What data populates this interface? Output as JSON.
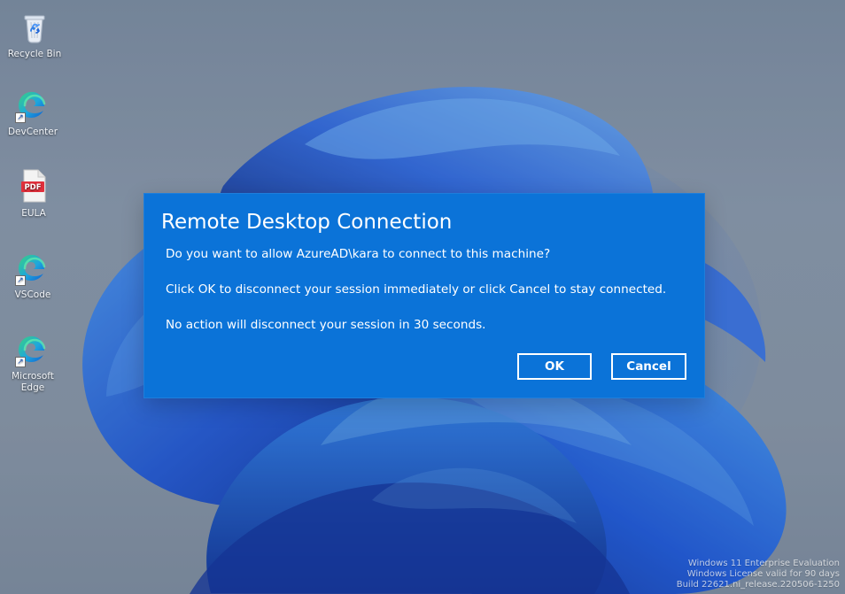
{
  "desktop": {
    "icons": [
      {
        "label": "Recycle Bin"
      },
      {
        "label": "DevCenter"
      },
      {
        "label": "EULA"
      },
      {
        "label": "VSCode"
      },
      {
        "label": "Microsoft Edge"
      }
    ],
    "watermark": {
      "line1": "Windows 11 Enterprise Evaluation",
      "line2": "Windows License valid for 90 days",
      "line3": "Build 22621.ni_release.220506-1250"
    }
  },
  "dialog": {
    "title": "Remote Desktop Connection",
    "lines": [
      "Do you want to allow AzureAD\\kara to connect to this machine?",
      "Click OK to disconnect your session immediately or click Cancel to stay connected.",
      "No action will disconnect your session in 30 seconds."
    ],
    "buttons": {
      "ok": "OK",
      "cancel": "Cancel"
    },
    "accent_color": "#0B73D8"
  },
  "icon_names": {
    "recycle": "recycle-bin-icon",
    "edge": "edge-icon",
    "pdf": "pdf-icon",
    "shortcut": "shortcut-arrow-icon"
  },
  "theme": {
    "desktop_background": "#8B9AAE",
    "wallpaper_blue": "#1F57D8",
    "dialog_text": "#FFFFFF"
  }
}
